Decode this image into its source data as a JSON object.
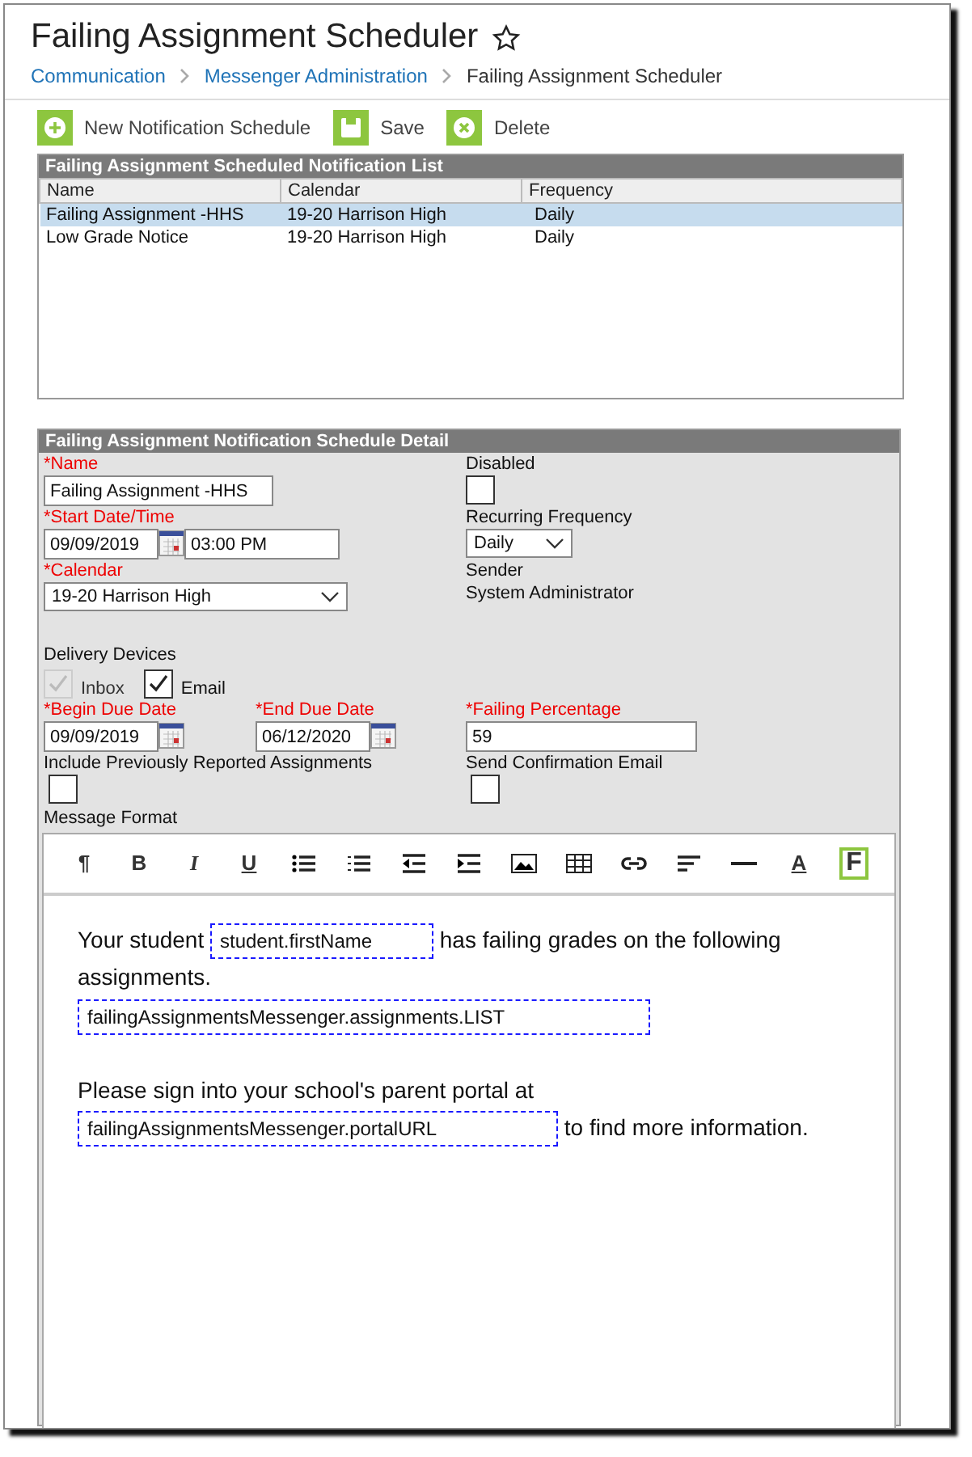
{
  "header": {
    "title": "Failing Assignment Scheduler",
    "favorite": false,
    "breadcrumbs": [
      {
        "label": "Communication",
        "link": true
      },
      {
        "label": "Messenger Administration",
        "link": true
      },
      {
        "label": "Failing Assignment Scheduler",
        "link": false
      }
    ]
  },
  "toolbar": [
    {
      "kind": "add",
      "label": "New Notification Schedule"
    },
    {
      "kind": "save",
      "label": "Save"
    },
    {
      "kind": "delete",
      "label": "Delete"
    }
  ],
  "list": {
    "title": "Failing Assignment Scheduled Notification List",
    "columns": [
      "Name",
      "Calendar",
      "Frequency"
    ],
    "rows": [
      {
        "cells": [
          "Failing Assignment -HHS",
          "19-20 Harrison High",
          "Daily"
        ],
        "selected": true
      },
      {
        "cells": [
          "Low Grade Notice",
          "19-20 Harrison High",
          "Daily"
        ],
        "selected": false
      }
    ]
  },
  "detail": {
    "title": "Failing Assignment Notification Schedule Detail",
    "name": {
      "label": "*Name",
      "required": true,
      "value": "Failing Assignment -HHS"
    },
    "disabled": {
      "label": "Disabled",
      "checked": false
    },
    "start": {
      "label": "*Start Date/Time",
      "required": true,
      "date": "09/09/2019",
      "time": "03:00 PM"
    },
    "frequency": {
      "label": "Recurring Frequency",
      "value": "Daily"
    },
    "calendar": {
      "label": "*Calendar",
      "required": true,
      "value": "19-20 Harrison High"
    },
    "sender": {
      "label": "Sender",
      "value": "System Administrator"
    },
    "delivery": {
      "label": "Delivery Devices",
      "options": [
        {
          "label": "Inbox",
          "checked": true,
          "disabled": true
        },
        {
          "label": "Email",
          "checked": true,
          "disabled": false
        }
      ]
    },
    "begin_due": {
      "label": "*Begin Due Date",
      "required": true,
      "value": "09/09/2019"
    },
    "end_due": {
      "label": "*End Due Date",
      "required": true,
      "value": "06/12/2020"
    },
    "failing_percentage": {
      "label": "*Failing Percentage",
      "required": true,
      "value": "59"
    },
    "include_previous": {
      "label": "Include Previously Reported Assignments",
      "checked": false
    },
    "send_confirmation": {
      "label": "Send Confirmation Email",
      "checked": false
    },
    "message_format": {
      "label": "Message Format"
    }
  },
  "editor": {
    "tools": [
      {
        "kind": "paragraph",
        "glyph": "¶",
        "selected": false
      },
      {
        "kind": "bold",
        "glyph": "B",
        "selected": false
      },
      {
        "kind": "italic",
        "glyph": "I",
        "selected": false
      },
      {
        "kind": "underline",
        "glyph": "U",
        "selected": false
      },
      {
        "kind": "bullets",
        "selected": false
      },
      {
        "kind": "numbers",
        "selected": false
      },
      {
        "kind": "outdent",
        "selected": false
      },
      {
        "kind": "indent",
        "selected": false
      },
      {
        "kind": "image",
        "selected": false
      },
      {
        "kind": "table",
        "selected": false
      },
      {
        "kind": "link",
        "selected": false
      },
      {
        "kind": "align",
        "selected": false
      },
      {
        "kind": "rule",
        "selected": false
      },
      {
        "kind": "color",
        "glyph": "A",
        "selected": false
      },
      {
        "kind": "format",
        "glyph": "F",
        "selected": true
      }
    ],
    "paragraphs": [
      [
        {
          "kind": "text",
          "text": "Your student "
        },
        {
          "kind": "field",
          "text": "student.firstName"
        },
        {
          "kind": "text",
          "text": " has failing grades on the following assignments."
        }
      ],
      [
        {
          "kind": "field",
          "text": "failingAssignmentsMessenger.assignments.LIST"
        }
      ],
      [
        {
          "kind": "blank"
        }
      ],
      [
        {
          "kind": "text",
          "text": "Please sign into your school's parent portal at "
        },
        {
          "kind": "field",
          "text": "failingAssignmentsMessenger.portalURL"
        },
        {
          "kind": "text",
          "text": " to find more information."
        }
      ]
    ]
  }
}
